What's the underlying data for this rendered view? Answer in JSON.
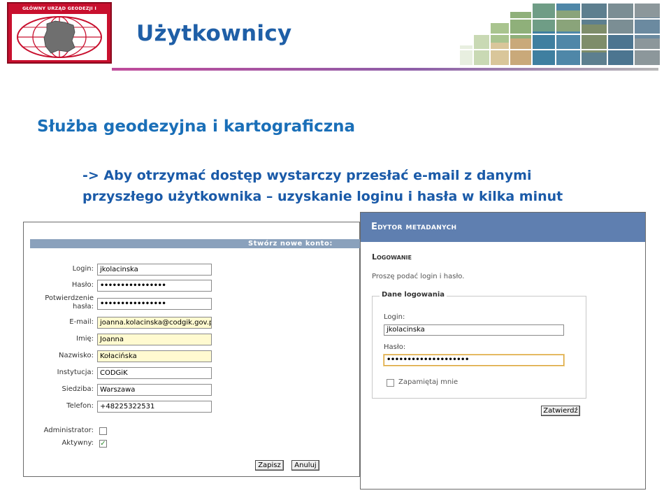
{
  "header": {
    "logo_text": "GŁÓWNY URZĄD GEODEZJI I KARTOGRAFII",
    "title": "Użytkownicy"
  },
  "content": {
    "subtitle": "Służba geodezyjna i kartograficzna",
    "bullet_line1": "-> Aby otrzymać dostęp wystarczy przesłać e-mail z danymi",
    "bullet_line2": "przyszłego użytkownika – uzyskanie loginu i hasła w kilka minut"
  },
  "create_form": {
    "title": "Stwórz nowe konto:",
    "fields": {
      "login": {
        "label": "Login:",
        "value": "jkolacinska"
      },
      "password": {
        "label": "Hasło:",
        "value": "••••••••••••••••"
      },
      "password_confirm": {
        "label_line1": "Potwierdzenie",
        "label_line2": "hasła:",
        "value": "••••••••••••••••"
      },
      "email": {
        "label": "E-mail:",
        "value": "joanna.kolacinska@codgik.gov.pl"
      },
      "first_name": {
        "label": "Imię:",
        "value": "Joanna"
      },
      "last_name": {
        "label": "Nazwisko:",
        "value": "Kołacińska"
      },
      "institution": {
        "label": "Instytucja:",
        "value": "CODGiK"
      },
      "seat": {
        "label": "Siedziba:",
        "value": "Warszawa"
      },
      "phone": {
        "label": "Telefon:",
        "value": "+48225322531"
      }
    },
    "administrator": {
      "label": "Administrator:",
      "checked": false
    },
    "active": {
      "label": "Aktywny:",
      "checked": true,
      "mark": "✓"
    },
    "save_label": "Zapisz",
    "cancel_label": "Anuluj"
  },
  "editor": {
    "header": "Edytor metadanych",
    "section": "Logowanie",
    "hint": "Proszę podać login i hasło.",
    "legend": "Dane logowania",
    "login_label": "Login:",
    "login_value": "jkolacinska",
    "password_label": "Hasło:",
    "password_value": "••••••••••••••••••••",
    "remember_label": "Zapamiętaj mnie",
    "submit_label": "Zatwierdź"
  },
  "colors": {
    "title_blue": "#1f5fa7",
    "logo_red": "#c8102e",
    "form_bar": "#8aa1bc",
    "editor_header": "#5f7fb0"
  }
}
